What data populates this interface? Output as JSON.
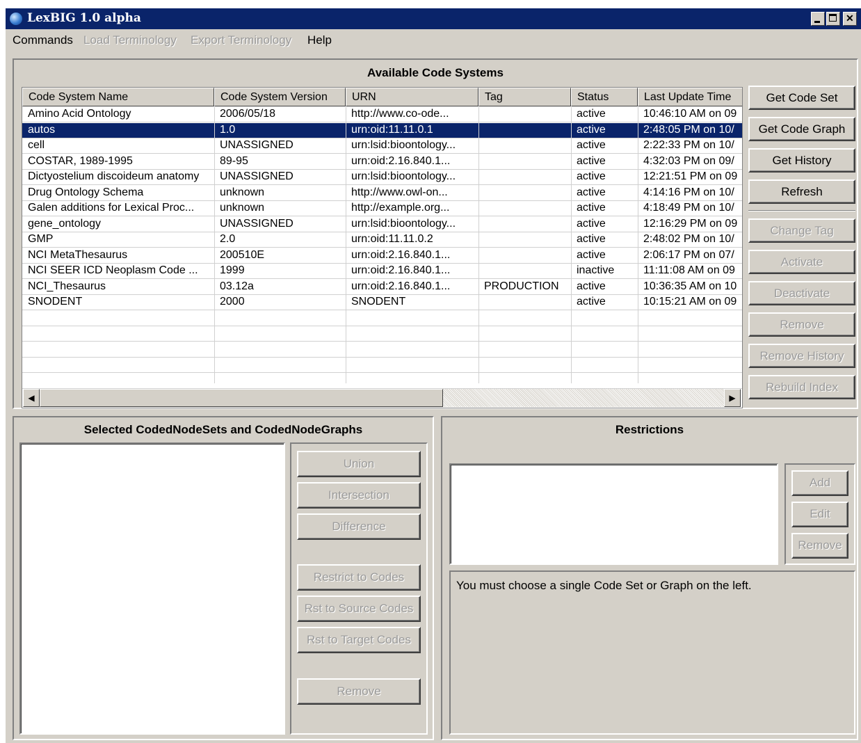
{
  "window": {
    "title": "LexBIG  1.0 alpha"
  },
  "menu": [
    {
      "label": "Commands",
      "enabled": true
    },
    {
      "label": "Load Terminology",
      "enabled": false
    },
    {
      "label": "Export Terminology",
      "enabled": false
    },
    {
      "label": "Help",
      "enabled": true
    }
  ],
  "code_systems": {
    "title": "Available Code Systems",
    "columns": [
      "Code System Name",
      "Code System Version",
      "URN",
      "Tag",
      "Status",
      "Last Update Time"
    ],
    "rows": [
      [
        "Amino Acid Ontology",
        "2006/05/18",
        "http://www.co-ode...",
        "",
        "active",
        "10:46:10 AM on 09"
      ],
      [
        "autos",
        "1.0",
        "urn:oid:11.11.0.1",
        "",
        "active",
        "2:48:05 PM on 10/"
      ],
      [
        "cell",
        "UNASSIGNED",
        "urn:lsid:bioontology...",
        "",
        "active",
        "2:22:33 PM on 10/"
      ],
      [
        "COSTAR, 1989-1995",
        "89-95",
        "urn:oid:2.16.840.1...",
        "",
        "active",
        "4:32:03 PM on 09/"
      ],
      [
        "Dictyostelium discoideum anatomy",
        "UNASSIGNED",
        "urn:lsid:bioontology...",
        "",
        "active",
        "12:21:51 PM on 09"
      ],
      [
        "Drug Ontology Schema",
        "unknown",
        "http://www.owl-on...",
        "",
        "active",
        "4:14:16 PM on 10/"
      ],
      [
        "Galen additions for Lexical Proc...",
        "unknown",
        "http://example.org...",
        "",
        "active",
        "4:18:49 PM on 10/"
      ],
      [
        "gene_ontology",
        "UNASSIGNED",
        "urn:lsid:bioontology...",
        "",
        "active",
        "12:16:29 PM on 09"
      ],
      [
        "GMP",
        "2.0",
        "urn:oid:11.11.0.2",
        "",
        "active",
        "2:48:02 PM on 10/"
      ],
      [
        "NCI MetaThesaurus",
        "200510E",
        "urn:oid:2.16.840.1...",
        "",
        "active",
        "2:06:17 PM on 07/"
      ],
      [
        "NCI SEER ICD Neoplasm Code ...",
        "1999",
        "urn:oid:2.16.840.1...",
        "",
        "inactive",
        "11:11:08 AM on 09"
      ],
      [
        "NCI_Thesaurus",
        "03.12a",
        "urn:oid:2.16.840.1...",
        "PRODUCTION",
        "active",
        "10:36:35 AM on 10"
      ],
      [
        "SNODENT",
        "2000",
        "SNODENT",
        "",
        "active",
        "10:15:21 AM on 09"
      ]
    ],
    "selected_row": 1,
    "buttons": [
      {
        "label": "Get Code Set",
        "enabled": true
      },
      {
        "label": "Get Code Graph",
        "enabled": true
      },
      {
        "label": "Get History",
        "enabled": true
      },
      {
        "label": "Refresh",
        "enabled": true
      },
      {
        "label": "Change Tag",
        "enabled": false
      },
      {
        "label": "Activate",
        "enabled": false
      },
      {
        "label": "Deactivate",
        "enabled": false
      },
      {
        "label": "Remove",
        "enabled": false
      },
      {
        "label": "Remove History",
        "enabled": false
      },
      {
        "label": "Rebuild Index",
        "enabled": false
      }
    ]
  },
  "selected_sets": {
    "title": "Selected CodedNodeSets and CodedNodeGraphs",
    "buttons": [
      {
        "label": "Union",
        "enabled": false
      },
      {
        "label": "Intersection",
        "enabled": false
      },
      {
        "label": "Difference",
        "enabled": false
      },
      {
        "label": "Restrict to Codes",
        "enabled": false
      },
      {
        "label": "Rst to Source Codes",
        "enabled": false
      },
      {
        "label": "Rst to Target Codes",
        "enabled": false
      },
      {
        "label": "Remove",
        "enabled": false
      }
    ]
  },
  "restrictions": {
    "title": "Restrictions",
    "buttons": [
      {
        "label": "Add",
        "enabled": false
      },
      {
        "label": "Edit",
        "enabled": false
      },
      {
        "label": "Remove",
        "enabled": false
      }
    ],
    "message": "You must choose a single Code Set or Graph on the left."
  }
}
